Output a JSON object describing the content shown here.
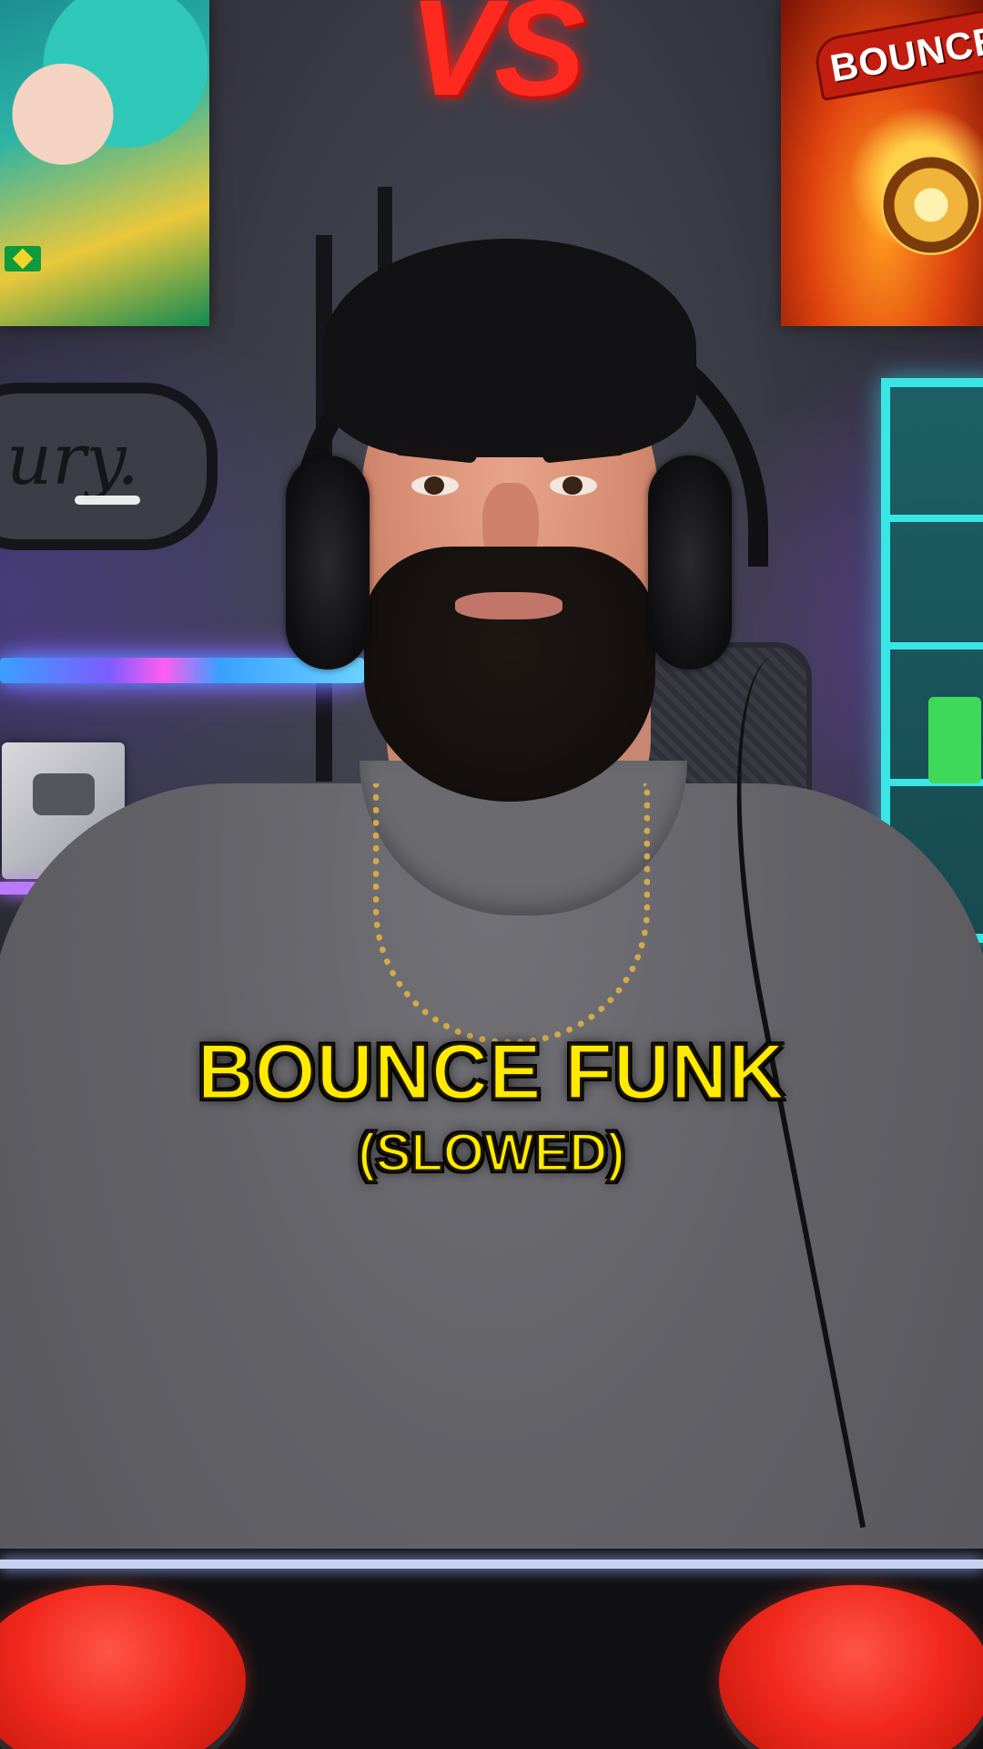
{
  "overlay": {
    "vs_logo": "VS",
    "caption_title": "BOUNCE FUNK",
    "caption_subtitle": "(SLOWED)"
  },
  "posters": {
    "right_poster_text": "BOUNCE"
  },
  "background": {
    "neon_sign_text": "ury."
  },
  "colors": {
    "caption": "#ffea00",
    "vs_logo": "#ff2a1f",
    "buzzer": "#f2291d",
    "shelf_neon": "#39e6e6"
  }
}
